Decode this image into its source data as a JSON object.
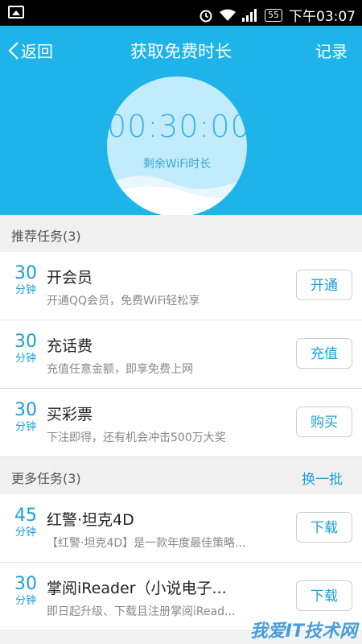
{
  "status_bar": {
    "battery": "55",
    "time": "下午03:07"
  },
  "header": {
    "back_label": "返回",
    "title": "获取免费时长",
    "record_label": "记录"
  },
  "timer": {
    "value": "00:30:00",
    "caption": "剩余WiFi时长"
  },
  "recommended": {
    "label": "推荐任务(3)",
    "tasks": [
      {
        "minutes": "30",
        "unit": "分钟",
        "name": "开会员",
        "desc": "开通QQ会员，免费WiFi轻松享",
        "button": "开通"
      },
      {
        "minutes": "30",
        "unit": "分钟",
        "name": "充话费",
        "desc": "充值任意金额，即享免费上网",
        "button": "充值"
      },
      {
        "minutes": "30",
        "unit": "分钟",
        "name": "买彩票",
        "desc": "下注即得，还有机会冲击500万大奖",
        "button": "购买"
      }
    ]
  },
  "more": {
    "label": "更多任务(3)",
    "refresh_label": "换一批",
    "tasks": [
      {
        "minutes": "45",
        "unit": "分钟",
        "name": "红警·坦克4D",
        "desc": "【红警·坦克4D】是一款年度最佳策略...",
        "button": "下载"
      },
      {
        "minutes": "30",
        "unit": "分钟",
        "name": "掌阅iReader（小说电子...",
        "desc": "即日起升级、下载且注册掌阅iRead...",
        "button": "下载"
      }
    ]
  },
  "watermark": "我爱IT技术网"
}
